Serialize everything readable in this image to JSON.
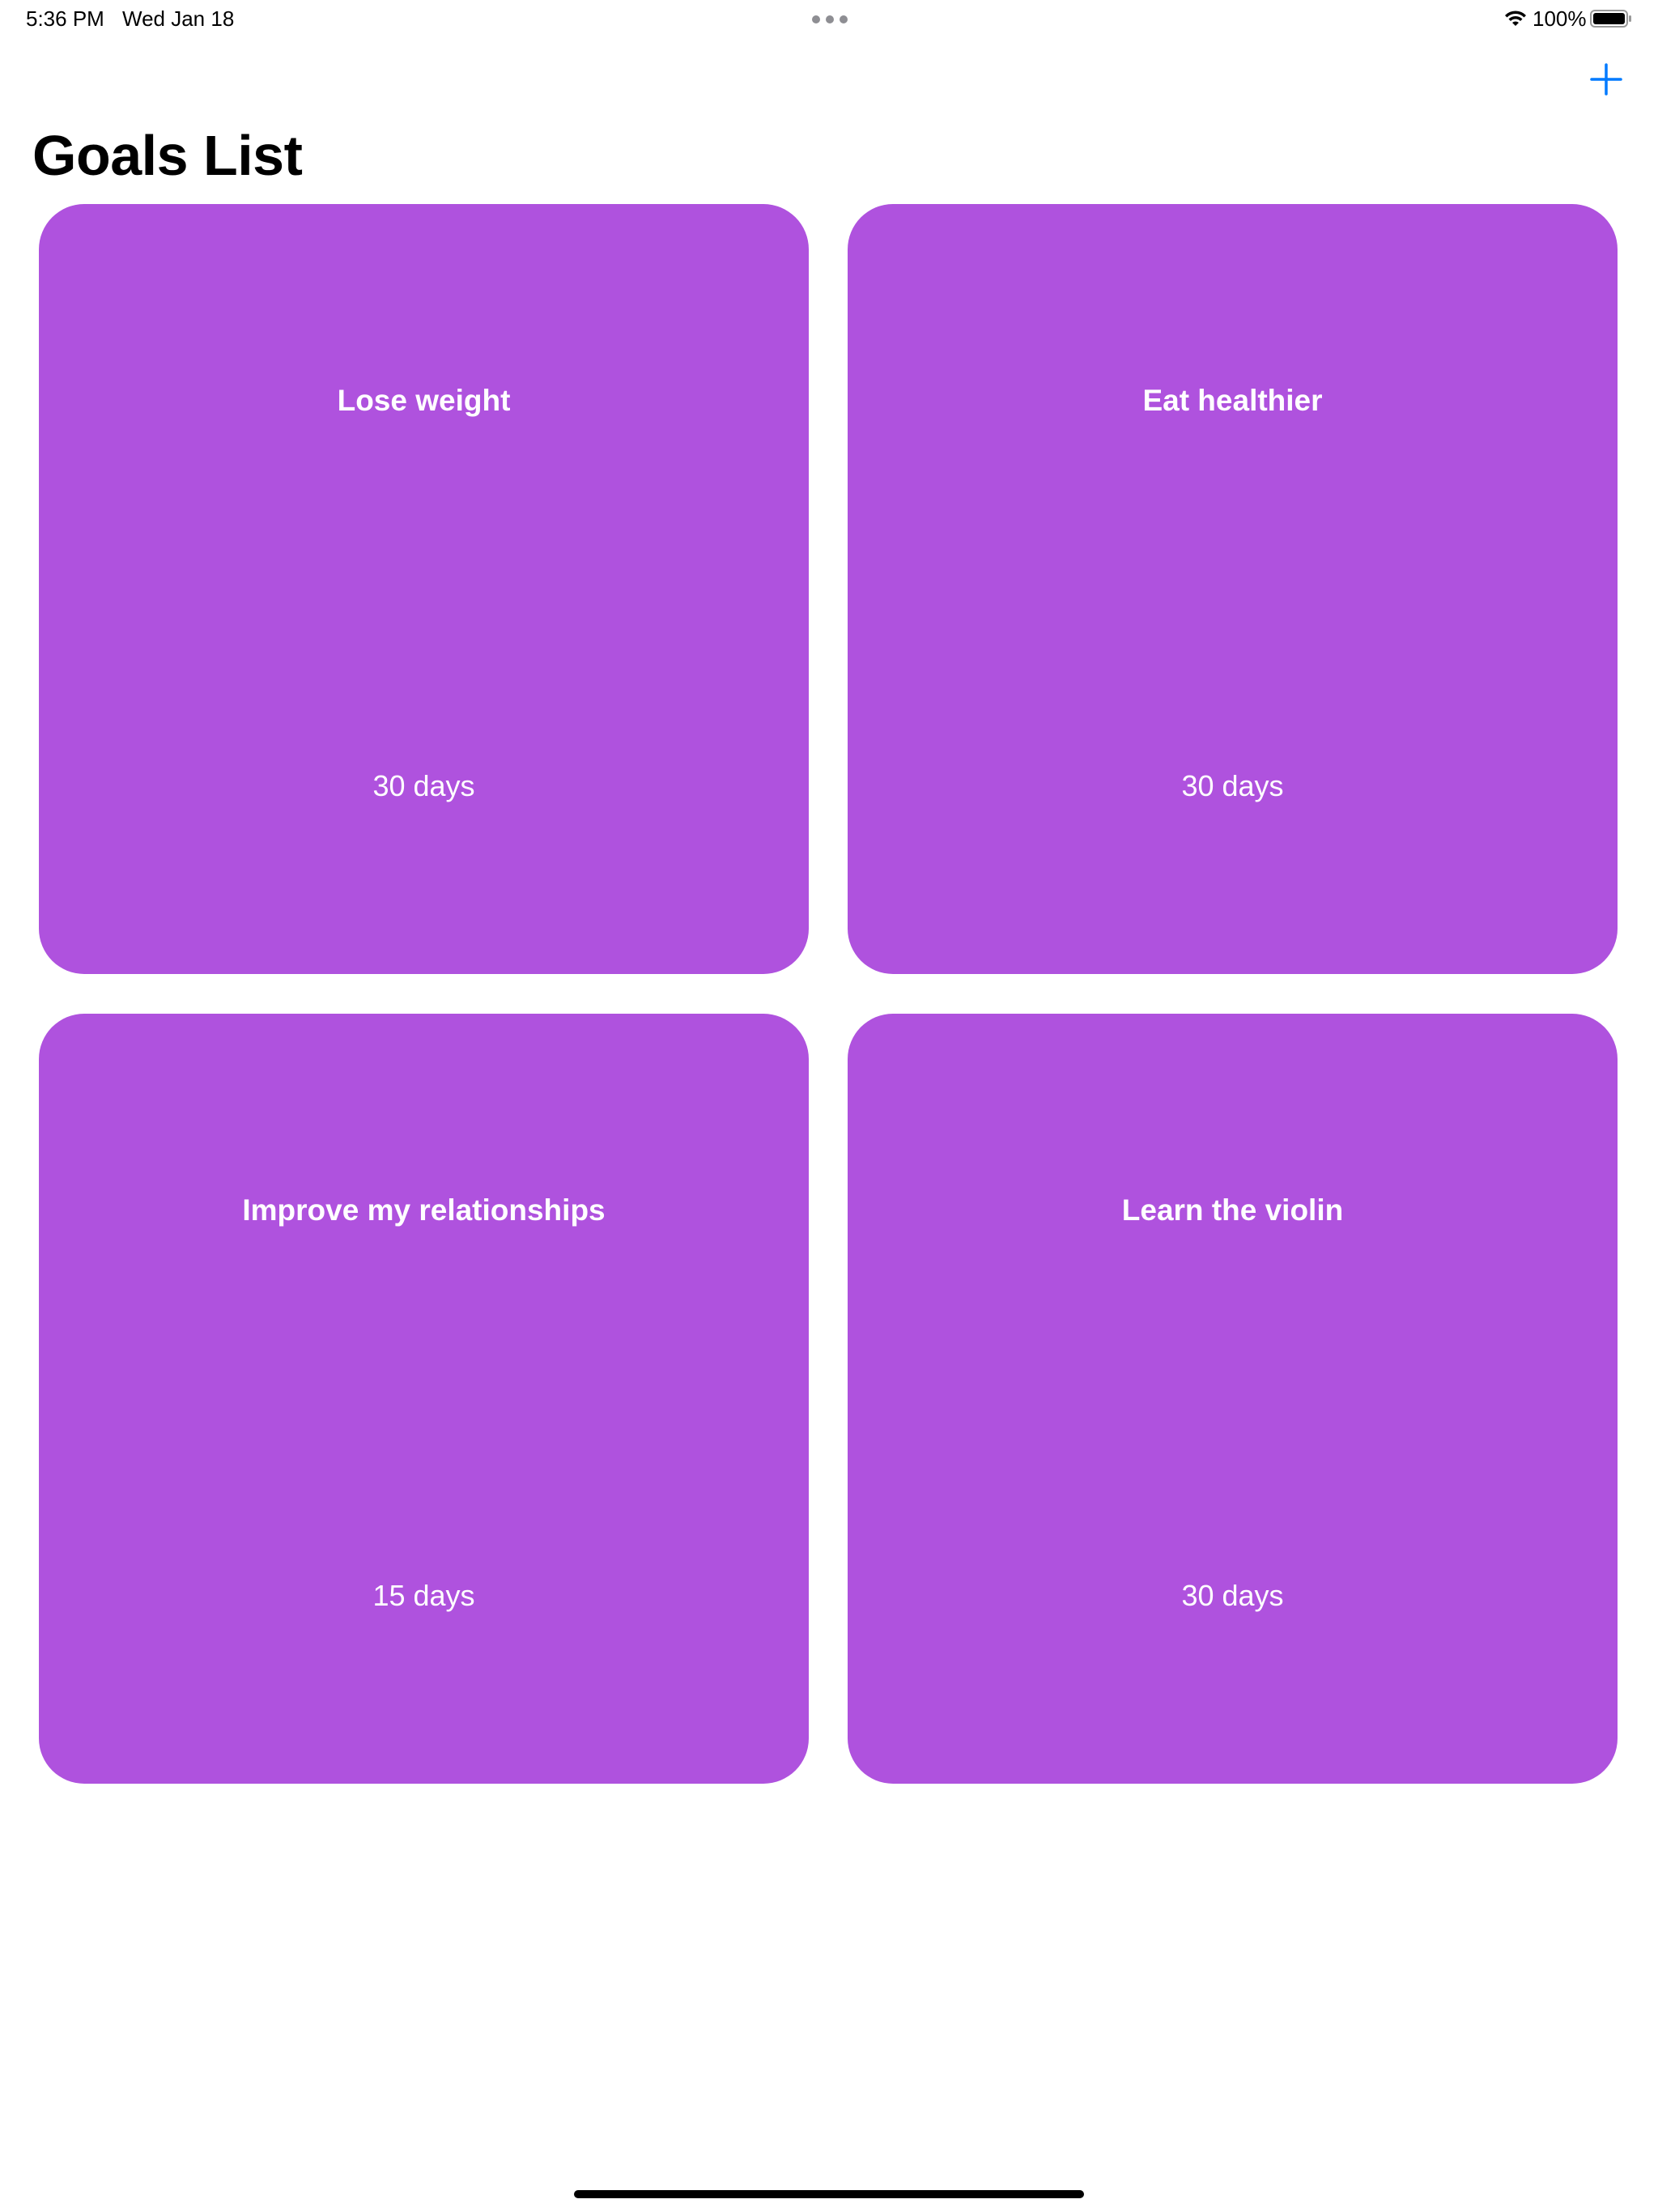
{
  "status_bar": {
    "time": "5:36 PM",
    "date": "Wed Jan 18",
    "battery_percent": "100%",
    "wifi_icon": "wifi-icon",
    "battery_icon": "battery-full-icon"
  },
  "navigation": {
    "title": "Goals List",
    "add_icon": "plus-icon",
    "accent_color": "#007aff"
  },
  "goals": [
    {
      "title": "Lose weight",
      "duration": "30 days"
    },
    {
      "title": "Eat healthier",
      "duration": "30 days"
    },
    {
      "title": "Improve my relationships",
      "duration": "15 days"
    },
    {
      "title": "Learn the violin",
      "duration": "30 days"
    }
  ],
  "theme": {
    "card_color": "#af52de",
    "card_text_color": "#ffffff",
    "background": "#ffffff"
  }
}
